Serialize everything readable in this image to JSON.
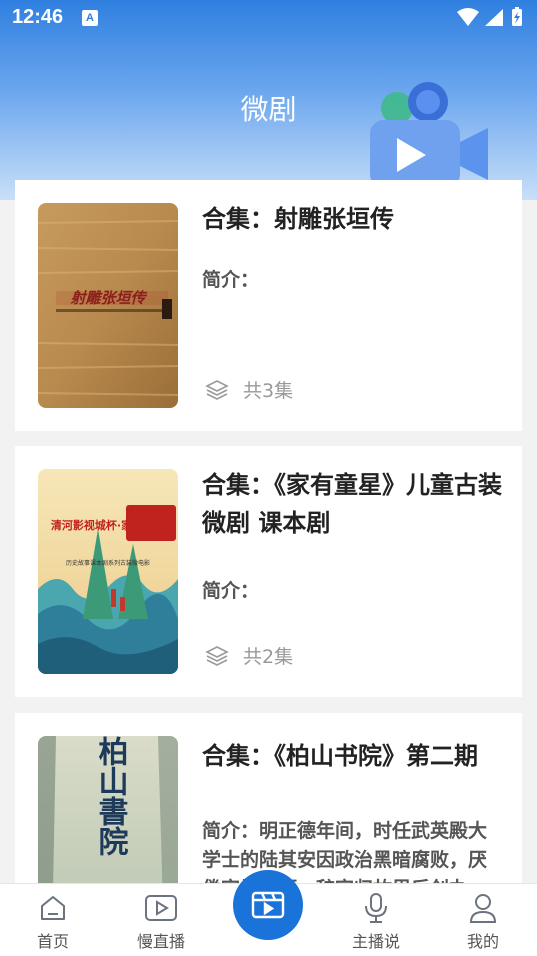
{
  "status_bar": {
    "time": "12:46",
    "notification_icon": "A"
  },
  "header": {
    "title": "微剧",
    "illustration": "video-camera-icon"
  },
  "collections": [
    {
      "title": "合集：射雕张垣传",
      "intro": "简介：",
      "episodes": "共3集",
      "poster_text": "射雕张垣传"
    },
    {
      "title": "合集：《家有童星》儿童古装微剧 课本剧",
      "intro": "简介：",
      "episodes": "共2集",
      "poster_text": "清河影视城杯·家有童星",
      "poster_subtext": "历史故事课本剧系列古装微电影"
    },
    {
      "title": "合集：《柏山书院》第二期",
      "intro": "简介：明正德年间，时任武英殿大学士的陆其安因政治黑暗腐败，厌倦官场生涯，辞官归故里后创办",
      "poster_text": "柏山書院"
    }
  ],
  "tabbar": {
    "items": [
      {
        "label": "首页",
        "icon": "home-icon"
      },
      {
        "label": "慢直播",
        "icon": "play-screen-icon"
      },
      {
        "label": "",
        "icon": "video-center-icon"
      },
      {
        "label": "主播说",
        "icon": "microphone-icon"
      },
      {
        "label": "我的",
        "icon": "user-icon"
      }
    ]
  },
  "colors": {
    "primary": "#1a73d9",
    "header_top": "#2f7fe0",
    "title_text": "#222222",
    "muted_text": "#999999"
  }
}
